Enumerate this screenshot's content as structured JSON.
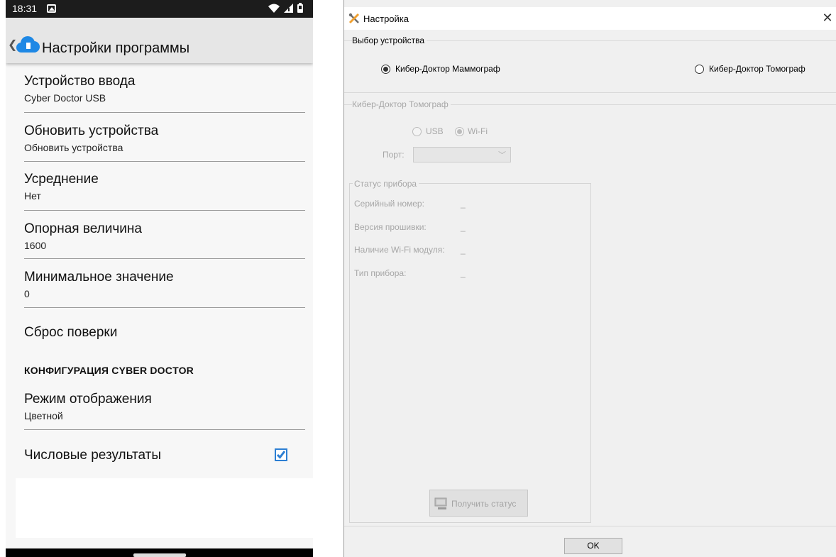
{
  "phone": {
    "status_bar": {
      "time": "18:31"
    },
    "app_bar": {
      "title": "Настройки программы"
    },
    "preferences": [
      {
        "title": "Устройство ввода",
        "summary": "Cyber Doctor USB"
      },
      {
        "title": "Обновить устройства",
        "summary": "Обновить устройства"
      },
      {
        "title": "Усреднение",
        "summary": "Нет"
      },
      {
        "title": "Опорная величина",
        "summary": "1600"
      },
      {
        "title": "Минимальное значение",
        "summary": "0"
      },
      {
        "title": "Сброс поверки"
      }
    ],
    "category": "КОНФИГУРАЦИЯ CYBER DOCTOR",
    "config_preferences": [
      {
        "title": "Режим отображения",
        "summary": "Цветной"
      },
      {
        "title": "Числовые результаты",
        "checked": true
      }
    ],
    "colors": {
      "accent": "#2d7fd3",
      "app_bar": "#e6e6e6",
      "background": "#f7f7f7"
    }
  },
  "dialog": {
    "title": "Настройка",
    "device_group": {
      "label": "Выбор устройства",
      "options": [
        {
          "label": "Кибер-Доктор Маммограф",
          "selected": true
        },
        {
          "label": "Кибер-Доктор Томограф",
          "selected": false
        }
      ]
    },
    "tomograph_group": {
      "label": "Кибер-Доктор Томограф",
      "connection_options": [
        {
          "label": "USB",
          "selected": false
        },
        {
          "label": "Wi-Fi",
          "selected": true
        }
      ],
      "port_label": "Порт:",
      "port_value": ""
    },
    "status_group": {
      "label": "Статус прибора",
      "rows": [
        {
          "label": "Серийный номер:",
          "value": "_"
        },
        {
          "label": "Версия прошивки:",
          "value": "_"
        },
        {
          "label": "Наличие Wi-Fi модуля:",
          "value": "_"
        },
        {
          "label": "Тип прибора:",
          "value": "_"
        }
      ],
      "button_label": "Получить статус"
    },
    "ok_label": "OK"
  }
}
